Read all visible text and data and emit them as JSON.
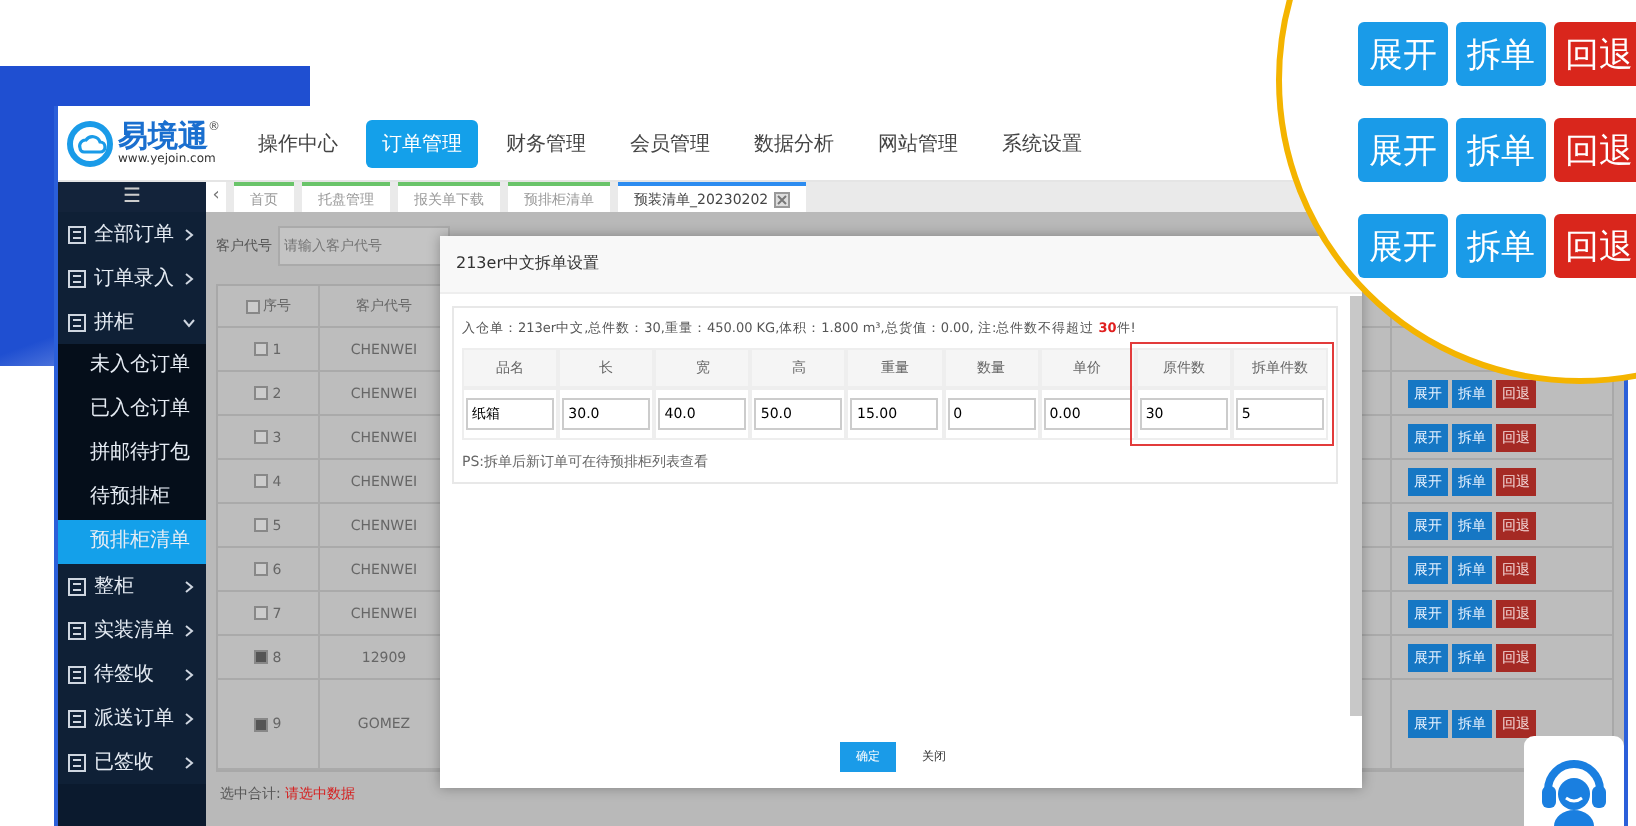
{
  "logo": {
    "name": "易境通",
    "mark": "®",
    "url": "www.yejoin.com"
  },
  "nav": [
    {
      "label": "操作中心",
      "selected": false
    },
    {
      "label": "订单管理",
      "selected": true
    },
    {
      "label": "财务管理",
      "selected": false
    },
    {
      "label": "会员管理",
      "selected": false
    },
    {
      "label": "数据分析",
      "selected": false
    },
    {
      "label": "网站管理",
      "selected": false
    },
    {
      "label": "系统设置",
      "selected": false
    }
  ],
  "menu_toggle": "☰",
  "tab_scroll": "‹",
  "tabs": [
    {
      "label": "首页",
      "selected": false
    },
    {
      "label": "托盘管理",
      "selected": false
    },
    {
      "label": "报关单下载",
      "selected": false
    },
    {
      "label": "预排柜清单",
      "selected": false
    },
    {
      "label": "预装清单_20230202",
      "selected": true
    }
  ],
  "sidebar": {
    "items": [
      {
        "label": "全部订单",
        "expanded": false
      },
      {
        "label": "订单录入",
        "expanded": false
      },
      {
        "label": "拼柜",
        "expanded": true,
        "children": [
          {
            "label": "未入仓订单",
            "selected": false
          },
          {
            "label": "已入仓订单",
            "selected": false
          },
          {
            "label": "拼邮待打包",
            "selected": false
          },
          {
            "label": "待预排柜",
            "selected": false
          },
          {
            "label": "预排柜清单",
            "selected": true
          }
        ]
      },
      {
        "label": "整柜",
        "expanded": false
      },
      {
        "label": "实装清单",
        "expanded": false
      },
      {
        "label": "待签收",
        "expanded": false
      },
      {
        "label": "派送订单",
        "expanded": false
      },
      {
        "label": "已签收",
        "expanded": false
      }
    ]
  },
  "filter": {
    "label": "客户代号",
    "placeholder": "请输入客户代号"
  },
  "table": {
    "header_checked": false,
    "columns": [
      "序号",
      "客户代号"
    ],
    "rows": [
      {
        "checked": false,
        "index": "1",
        "customer": "CHENWEI"
      },
      {
        "checked": false,
        "index": "2",
        "customer": "CHENWEI",
        "actions": [
          {
            "label": "展开",
            "kind": "primary"
          },
          {
            "label": "拆单",
            "kind": "primary"
          },
          {
            "label": "回退",
            "kind": "danger"
          }
        ]
      },
      {
        "checked": false,
        "index": "3",
        "customer": "CHENWEI",
        "actions": [
          {
            "label": "展开",
            "kind": "primary"
          },
          {
            "label": "拆单",
            "kind": "primary"
          },
          {
            "label": "回退",
            "kind": "danger"
          }
        ]
      },
      {
        "checked": false,
        "index": "4",
        "customer": "CHENWEI",
        "actions": [
          {
            "label": "展开",
            "kind": "primary"
          },
          {
            "label": "拆单",
            "kind": "primary"
          },
          {
            "label": "回退",
            "kind": "danger"
          }
        ]
      },
      {
        "checked": false,
        "index": "5",
        "customer": "CHENWEI",
        "actions": [
          {
            "label": "展开",
            "kind": "primary"
          },
          {
            "label": "拆单",
            "kind": "primary"
          },
          {
            "label": "回退",
            "kind": "danger"
          }
        ]
      },
      {
        "checked": false,
        "index": "6",
        "customer": "CHENWEI",
        "actions": [
          {
            "label": "展开",
            "kind": "primary"
          },
          {
            "label": "拆单",
            "kind": "primary"
          },
          {
            "label": "回退",
            "kind": "danger"
          }
        ]
      },
      {
        "checked": false,
        "index": "7",
        "customer": "CHENWEI",
        "actions": [
          {
            "label": "展开",
            "kind": "primary"
          },
          {
            "label": "拆单",
            "kind": "primary"
          },
          {
            "label": "回退",
            "kind": "danger"
          }
        ]
      },
      {
        "checked": true,
        "index": "8",
        "customer": "12909",
        "actions": [
          {
            "label": "展开",
            "kind": "primary"
          },
          {
            "label": "拆单",
            "kind": "primary"
          },
          {
            "label": "回退",
            "kind": "danger"
          }
        ]
      },
      {
        "checked": true,
        "index": "9",
        "customer": "GOMEZ",
        "tall": true,
        "actions": [
          {
            "label": "展开",
            "kind": "primary"
          },
          {
            "label": "拆单",
            "kind": "primary"
          },
          {
            "label": "回退",
            "kind": "danger"
          }
        ]
      }
    ],
    "footer": {
      "label": "选中合计:",
      "value": "请选中数据"
    }
  },
  "dialog": {
    "title": "213er中文拆单设置",
    "info": "入仓单：213er中文,总件数：30,重量：450.00 KG,体积：1.800 m³,总货值：0.00, 注:总件数不得超过 **30**件!",
    "columns": [
      {
        "header": "品名",
        "value": "纸箱",
        "highlighted": false
      },
      {
        "header": "长",
        "value": "30.0",
        "highlighted": false
      },
      {
        "header": "宽",
        "value": "40.0",
        "highlighted": false
      },
      {
        "header": "高",
        "value": "50.0",
        "highlighted": false
      },
      {
        "header": "重量",
        "value": "15.00",
        "highlighted": false
      },
      {
        "header": "数量",
        "value": "0",
        "highlighted": false
      },
      {
        "header": "单价",
        "value": "0.00",
        "highlighted": false
      },
      {
        "header": "原件数",
        "value": "30",
        "highlighted": true
      },
      {
        "header": "拆单件数",
        "value": "5",
        "highlighted": true
      }
    ],
    "note": "PS:拆单后新订单可在待预排柜列表查看",
    "buttons": [
      {
        "label": "确定",
        "kind": "primary"
      },
      {
        "label": "关闭",
        "kind": "default"
      }
    ]
  },
  "magnifier": {
    "rows": [
      [
        {
          "label": "展开",
          "kind": "primary"
        },
        {
          "label": "拆单",
          "kind": "primary"
        },
        {
          "label": "回退",
          "kind": "danger"
        }
      ],
      [
        {
          "label": "展开",
          "kind": "primary"
        },
        {
          "label": "拆单",
          "kind": "primary"
        },
        {
          "label": "回退",
          "kind": "danger"
        }
      ],
      [
        {
          "label": "展开",
          "kind": "primary"
        },
        {
          "label": "拆单",
          "kind": "primary"
        },
        {
          "label": "回退",
          "kind": "danger"
        }
      ]
    ]
  }
}
